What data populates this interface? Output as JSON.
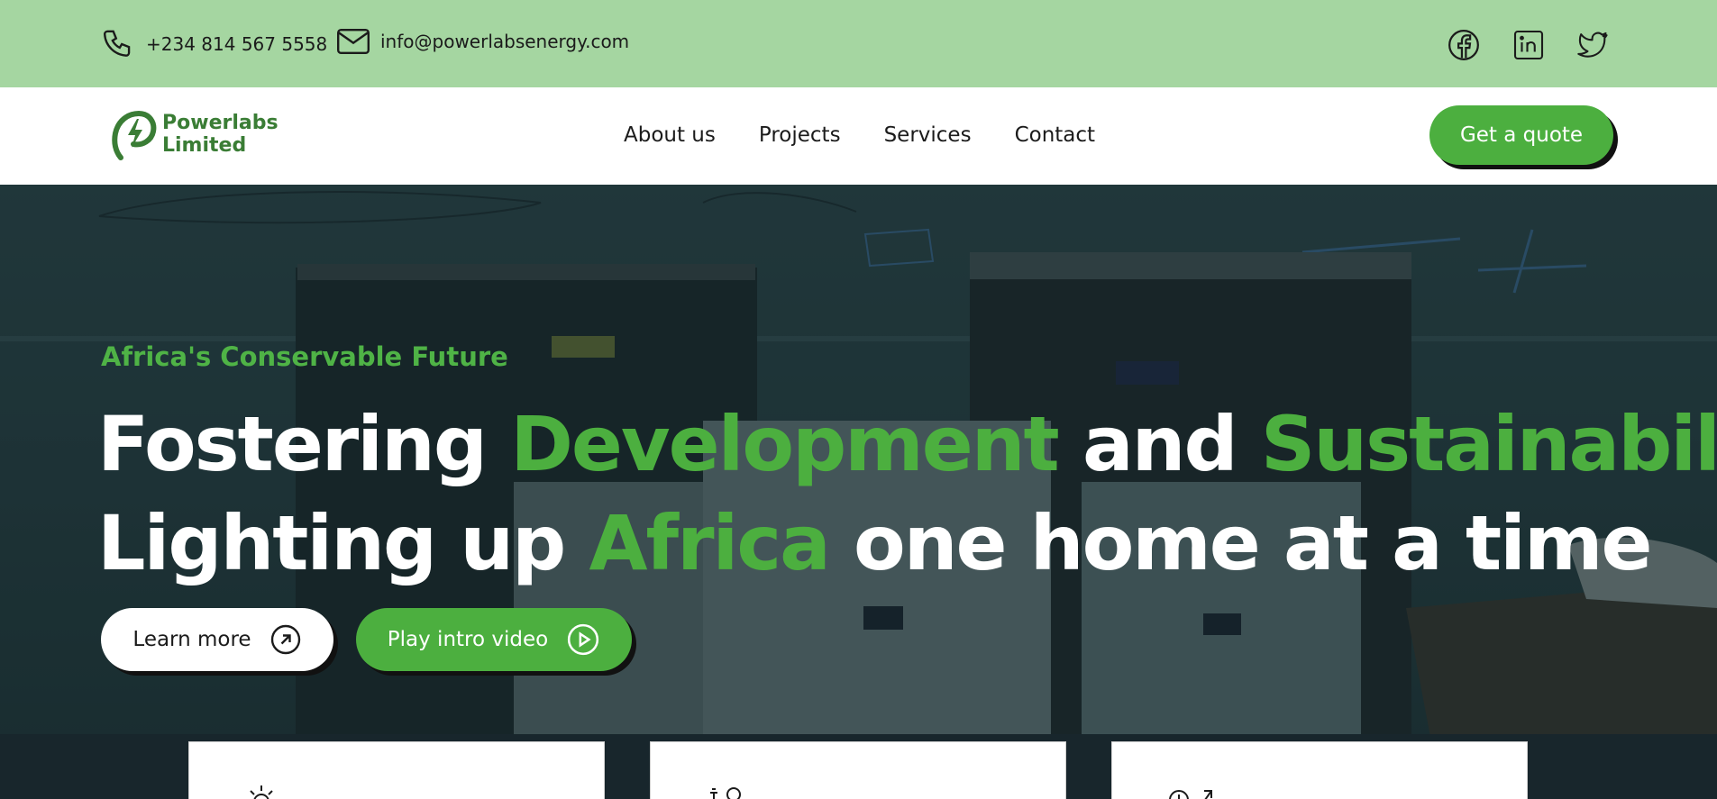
{
  "topbar": {
    "phone": "+234 814 567 5558",
    "email": "info@powerlabsenergy.com",
    "social": [
      "facebook-icon",
      "linkedin-icon",
      "twitter-icon"
    ]
  },
  "nav": {
    "logo_line1": "Powerlabs",
    "logo_line2": "Limited",
    "menu": [
      "About us",
      "Projects",
      "Services",
      "Contact"
    ],
    "cta": "Get a quote"
  },
  "hero": {
    "tagline": "Africa's Conservable Future",
    "line1": [
      "Fostering ",
      "Development",
      " and ",
      "Sustainability"
    ],
    "line2": [
      "Lighting up ",
      "Africa",
      " one home at a time"
    ],
    "learn_more": "Learn more",
    "play_video": "Play intro video"
  },
  "colors": {
    "accent": "#4caf3f",
    "topbar": "#a5d6a1",
    "logo": "#3a7d35"
  }
}
